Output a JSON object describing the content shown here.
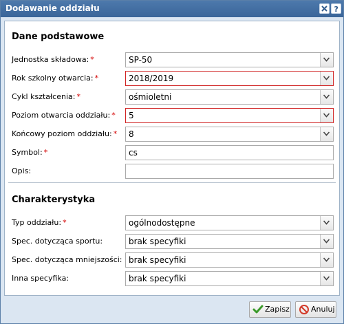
{
  "window": {
    "title": "Dodawanie oddziału"
  },
  "sections": {
    "basic": "Dane podstawowe",
    "characteristics": "Charakterystyka"
  },
  "fields": [
    {
      "label": "Jednostka składowa:",
      "required": true,
      "value": "SP-50",
      "type": "select",
      "error": false
    },
    {
      "label": "Rok szkolny otwarcia:",
      "required": true,
      "value": "2018/2019",
      "type": "select",
      "error": true
    },
    {
      "label": "Cykl kształcenia:",
      "required": true,
      "value": "ośmioletni",
      "type": "select",
      "error": false
    },
    {
      "label": "Poziom otwarcia oddziału:",
      "required": true,
      "value": "5",
      "type": "select",
      "error": true
    },
    {
      "label": "Końcowy poziom oddziału:",
      "required": true,
      "value": "8",
      "type": "select",
      "error": false
    },
    {
      "label": "Symbol:",
      "required": true,
      "value": "cs",
      "type": "text",
      "error": false
    },
    {
      "label": "Opis:",
      "required": false,
      "value": "",
      "type": "text",
      "error": false
    }
  ],
  "char_fields": [
    {
      "label": "Typ oddziału:",
      "required": true,
      "value": "ogólnodostępne",
      "type": "select",
      "error": false
    },
    {
      "label": "Spec. dotycząca sportu:",
      "required": false,
      "value": "brak specyfiki",
      "type": "select",
      "error": false
    },
    {
      "label": "Spec. dotycząca mniejszości:",
      "required": false,
      "value": "brak specyfiki",
      "type": "select",
      "error": false
    },
    {
      "label": "Inna specyfika:",
      "required": false,
      "value": "brak specyfiki",
      "type": "select",
      "error": false
    }
  ],
  "required_marker": "*",
  "buttons": {
    "save": "Zapisz",
    "cancel": "Anuluj"
  },
  "colors": {
    "titlebar": "#3f6c9f",
    "error_border": "#d12424",
    "required": "#d40000"
  }
}
